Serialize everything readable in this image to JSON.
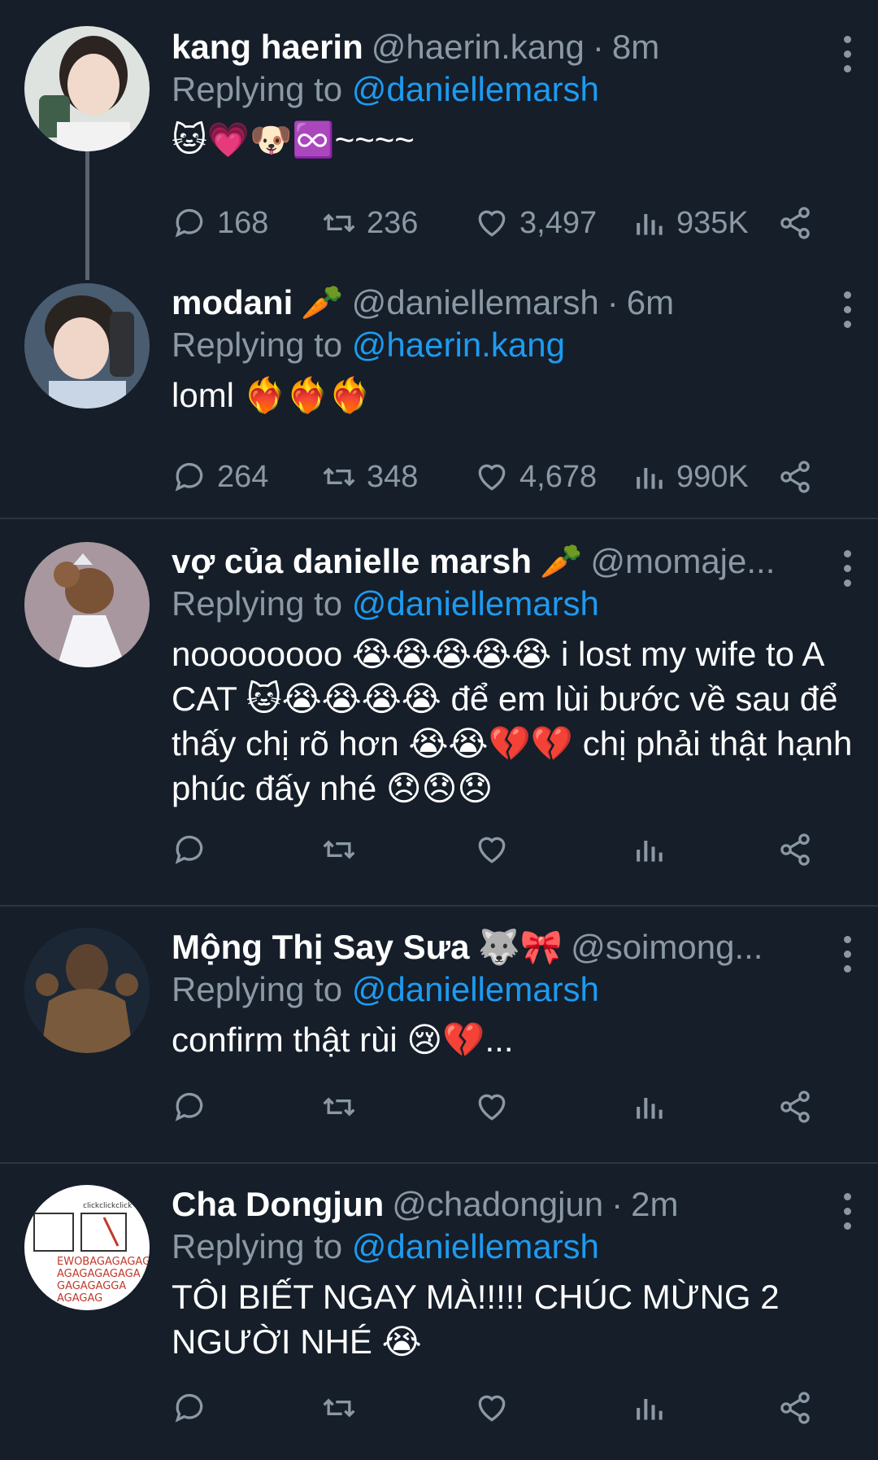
{
  "tweets": [
    {
      "name": "kang haerin",
      "name_emoji": "",
      "handle": "@haerin.kang",
      "time": "8m",
      "replying_prefix": "Replying to",
      "replying_to": "@daniellemarsh",
      "text": "🐱💗🐶♾️~~~~",
      "replies": "168",
      "retweets": "236",
      "likes": "3,497",
      "views": "935K",
      "avatar_colors": [
        "#d9d9d9",
        "#3c4a3d"
      ]
    },
    {
      "name": "modani",
      "name_emoji": "🥕",
      "handle": "@daniellemarsh",
      "time": "6m",
      "replying_prefix": "Replying to",
      "replying_to": "@haerin.kang",
      "text": "loml ❤️‍🔥❤️‍🔥❤️‍🔥",
      "replies": "264",
      "retweets": "348",
      "likes": "4,678",
      "views": "990K",
      "avatar_colors": [
        "#6a7c93",
        "#d6c2b8"
      ]
    },
    {
      "name": "vợ của danielle marsh",
      "name_emoji": "🥕",
      "handle": "@momaje...",
      "time": "",
      "replying_prefix": "Replying to",
      "replying_to": "@daniellemarsh",
      "text": "noooooooo 😭😭😭😭😭 i lost my wife to A CAT 🐱😭😭😭😭 để em lùi bước về sau để thấy chị rõ hơn 😭😭💔💔 chị phải thật hạnh phúc đấy nhé 😞😞😞",
      "replies": "",
      "retweets": "",
      "likes": "",
      "views": "",
      "avatar_colors": [
        "#9d8a93",
        "#6b4a35"
      ]
    },
    {
      "name": "Mộng Thị Say Sưa",
      "name_emoji": "🐺🎀",
      "handle": "@soimong...",
      "time": "",
      "replying_prefix": "Replying to",
      "replying_to": "@daniellemarsh",
      "text": "confirm thật rùi 😢💔...",
      "replies": "",
      "retweets": "",
      "likes": "",
      "views": "",
      "avatar_colors": [
        "#1f2a3a",
        "#6b5238"
      ]
    },
    {
      "name": "Cha Dongjun",
      "name_emoji": "",
      "handle": "@chadongjun",
      "time": "2m",
      "replying_prefix": "Replying to",
      "replying_to": "@daniellemarsh",
      "text": "TÔI BIẾT NGAY MÀ!!!!! CHÚC MỪNG 2 NGƯỜI NHÉ 😭",
      "replies": "",
      "retweets": "",
      "likes": "",
      "views": "",
      "avatar_colors": [
        "#ffffff",
        "#c0392b"
      ],
      "avatar_text": "EWOBAGAGAGAGAGAGAGAGAGAGGAAGAGAG"
    }
  ],
  "colors": {
    "background": "#151e29",
    "muted": "#8b98a5",
    "link": "#1d9bf0",
    "divider": "#2c3642"
  }
}
